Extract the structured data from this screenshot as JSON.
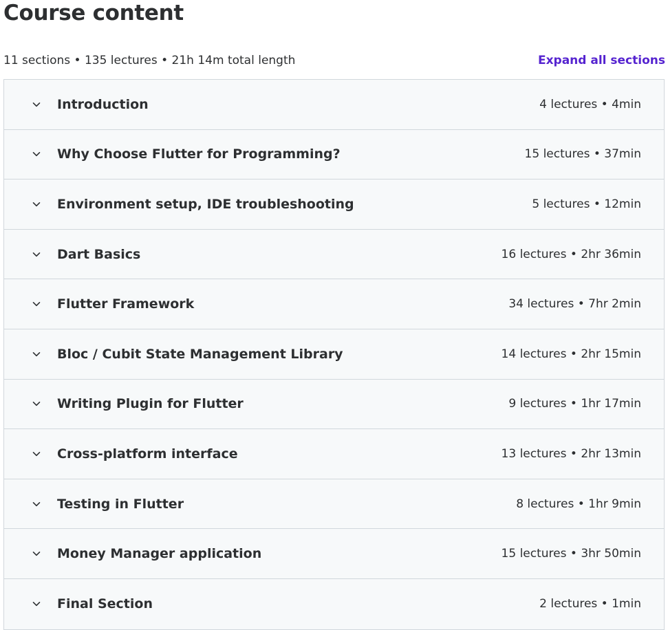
{
  "header": {
    "title": "Course content"
  },
  "summary": {
    "text": "11 sections • 135 lectures • 21h 14m total length",
    "expand_label": "Expand all sections"
  },
  "icons": {
    "section_toggle": "chevron-down-icon"
  },
  "colors": {
    "text": "#2d2f31",
    "link": "#5624d0",
    "row_background": "#f7f9fa",
    "border": "#d1d7dc"
  },
  "sections": [
    {
      "title": "Introduction",
      "meta": "4 lectures • 4min"
    },
    {
      "title": "Why Choose Flutter for Programming?",
      "meta": "15 lectures • 37min"
    },
    {
      "title": "Environment setup, IDE troubleshooting",
      "meta": "5 lectures • 12min"
    },
    {
      "title": "Dart Basics",
      "meta": "16 lectures • 2hr 36min"
    },
    {
      "title": "Flutter Framework",
      "meta": "34 lectures • 7hr 2min"
    },
    {
      "title": "Bloc / Cubit State Management Library",
      "meta": "14 lectures • 2hr 15min"
    },
    {
      "title": "Writing Plugin for Flutter",
      "meta": "9 lectures • 1hr 17min"
    },
    {
      "title": "Cross-platform interface",
      "meta": "13 lectures • 2hr 13min"
    },
    {
      "title": "Testing in Flutter",
      "meta": "8 lectures • 1hr 9min"
    },
    {
      "title": "Money Manager application",
      "meta": "15 lectures • 3hr 50min"
    },
    {
      "title": "Final Section",
      "meta": "2 lectures • 1min"
    }
  ]
}
